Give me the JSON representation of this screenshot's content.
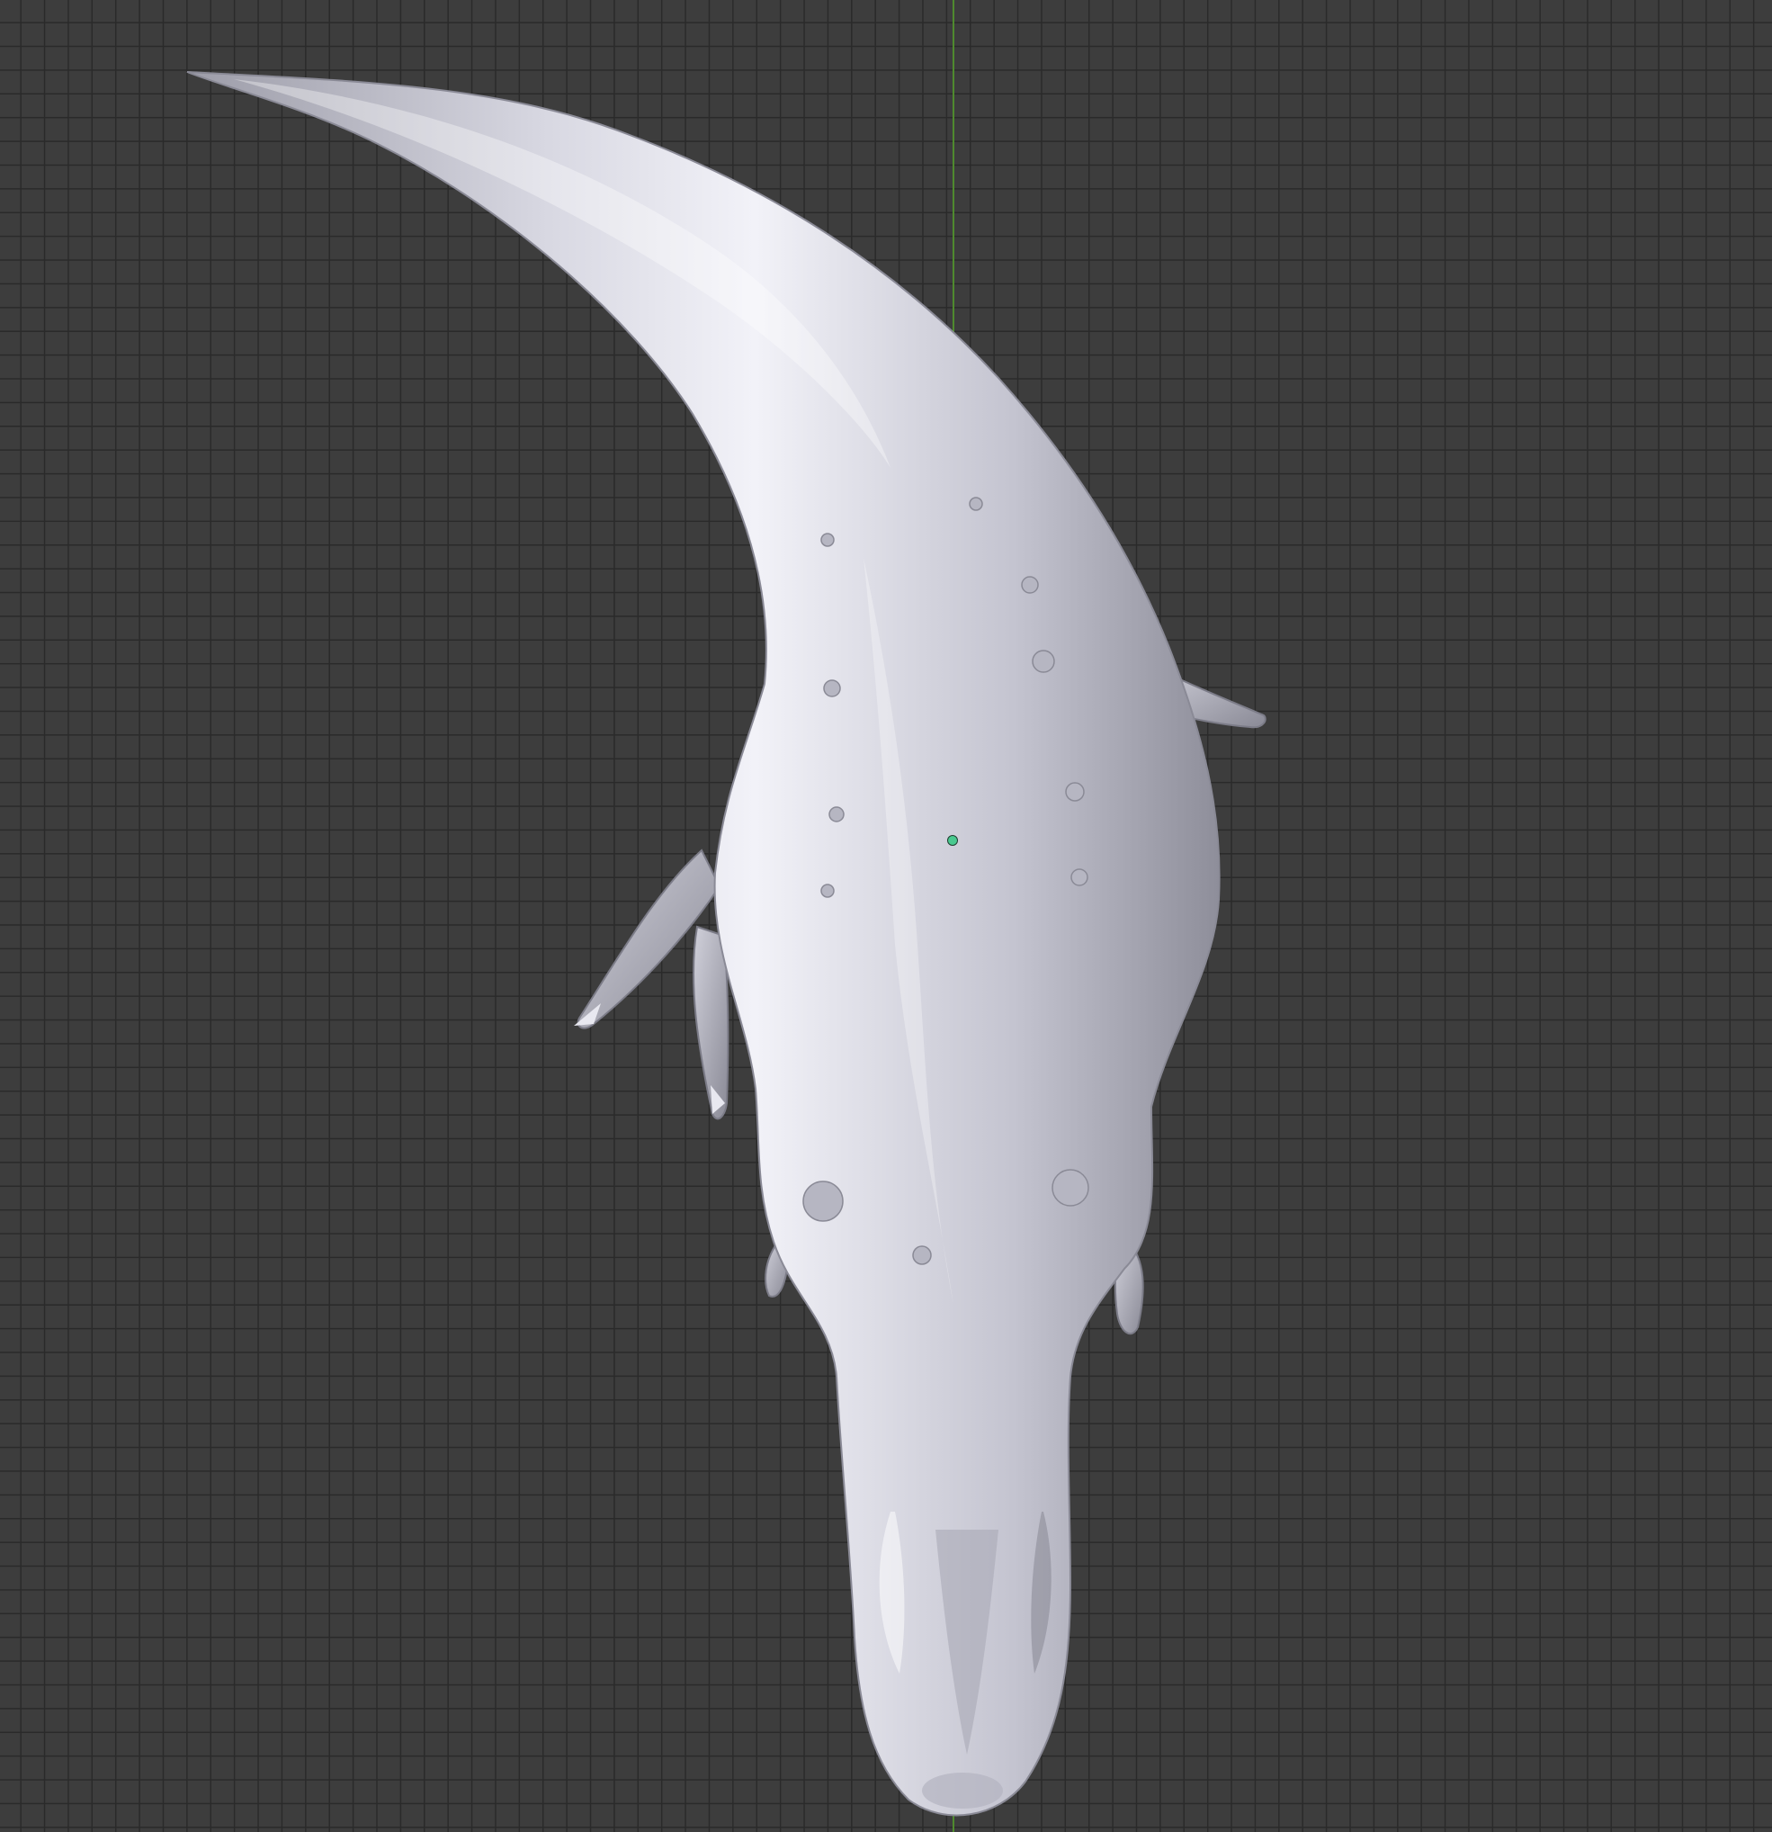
{
  "viewport": {
    "background_color": "#3d3d3d",
    "grid_line_color": "#2a2a2a",
    "axis_color": "#4f8a2e",
    "origin_color": "#49c98f",
    "model_color": "#c8c8d2"
  },
  "model": {
    "subject": "dinosaur-sculpt-top-view",
    "icon": "mesh-icon"
  }
}
